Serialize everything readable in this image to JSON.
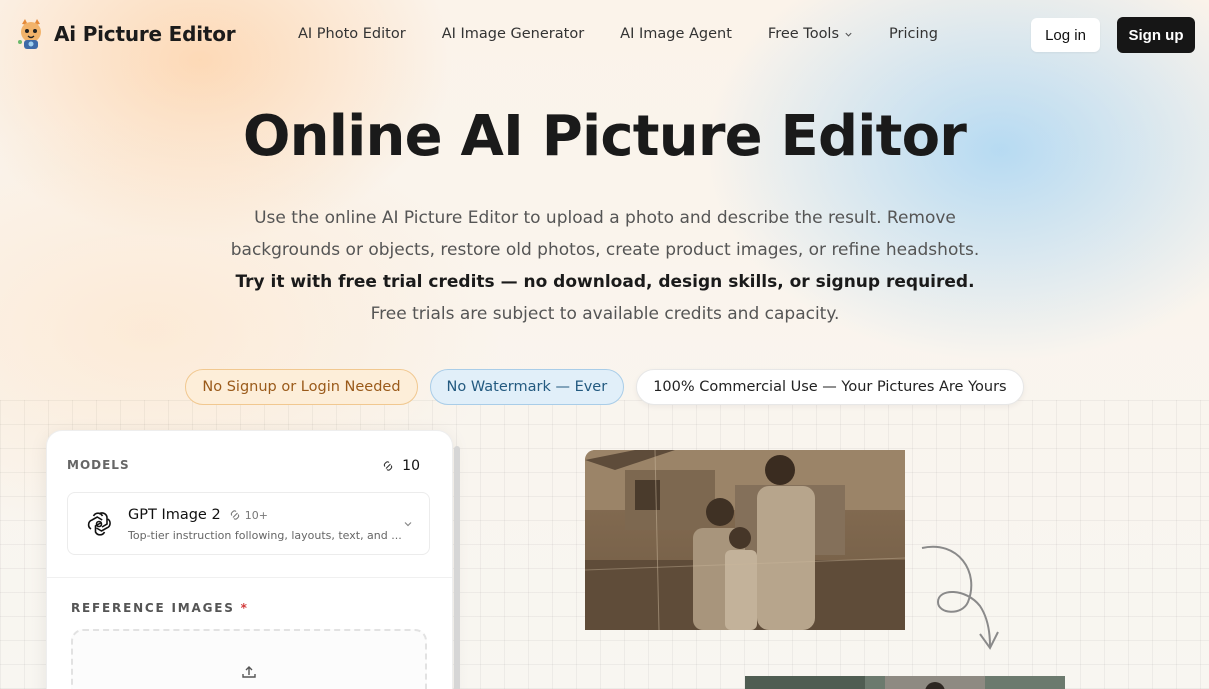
{
  "brand": {
    "name": "Ai Picture Editor",
    "logo_icon": "cat-mascot-logo"
  },
  "nav": {
    "links": [
      {
        "label": "AI Photo Editor"
      },
      {
        "label": "AI Image Generator"
      },
      {
        "label": "AI Image Agent"
      },
      {
        "label": "Free Tools",
        "has_dropdown": true
      },
      {
        "label": "Pricing"
      }
    ],
    "login_label": "Log in",
    "signup_label": "Sign up"
  },
  "hero": {
    "title": "Online AI Picture Editor",
    "desc_part1": "Use the online AI Picture Editor to upload a photo and describe the result. Remove backgrounds or objects, restore old photos, create product images, or refine headshots. ",
    "desc_bold": "Try it with free trial credits — no download, design skills, or signup required.",
    "desc_part2": " Free trials are subject to available credits and capacity."
  },
  "badges": [
    {
      "label": "No Signup or Login Needed",
      "color": "#fdeed9"
    },
    {
      "label": "No Watermark — Ever",
      "color": "#e1eff9"
    },
    {
      "label": "100% Commercial Use — Your Pictures Are Yours",
      "color": "#ffffff"
    }
  ],
  "panel": {
    "models_heading": "MODELS",
    "credits": "10",
    "model": {
      "name": "GPT Image 2",
      "credit_cost": "10+",
      "description": "Top-tier instruction following, layouts, text, and ...",
      "icon": "openai-icon"
    },
    "reference_heading": "REFERENCE IMAGES",
    "required_marker": "*"
  },
  "colors": {
    "accent_dark": "#161616",
    "badge_orange_text": "#9a5a1a",
    "badge_blue_text": "#235a80"
  }
}
